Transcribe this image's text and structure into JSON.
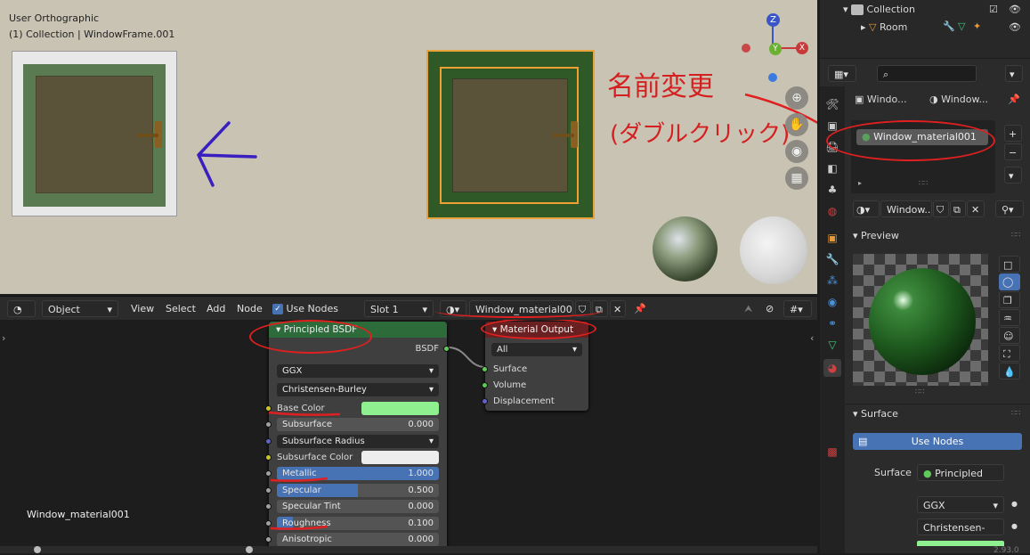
{
  "viewport": {
    "view_name": "User Orthographic",
    "collection_line": "(1) Collection | WindowFrame.001",
    "annotation_line1": "名前変更",
    "annotation_line2": "(ダブルクリック)",
    "gizmo_z": "Z",
    "gizmo_y": "Y",
    "gizmo_x": "X"
  },
  "node_header": {
    "editor_type": "Object",
    "menus": [
      "View",
      "Select",
      "Add",
      "Node"
    ],
    "use_nodes_label": "Use Nodes",
    "use_nodes_checked": true,
    "slot": "Slot 1",
    "material_name": "Window_material001"
  },
  "node_editor": {
    "material_label": "Window_material001",
    "bsdf_node": {
      "title": "Principled BSDF",
      "output_label": "BSDF",
      "distribution": "GGX",
      "subsurface_method": "Christensen-Burley",
      "base_color_label": "Base Color",
      "base_color": "#8ff08f",
      "subsurface": {
        "label": "Subsurface",
        "value": "0.000"
      },
      "subsurface_radius": "Subsurface Radius",
      "subsurface_color_label": "Subsurface Color",
      "metallic": {
        "label": "Metallic",
        "value": "1.000",
        "fraction": 1.0
      },
      "specular": {
        "label": "Specular",
        "value": "0.500",
        "fraction": 0.5
      },
      "specular_tint": {
        "label": "Specular Tint",
        "value": "0.000"
      },
      "roughness": {
        "label": "Roughness",
        "value": "0.100",
        "fraction": 0.1
      },
      "anisotropic": {
        "label": "Anisotropic",
        "value": "0.000"
      }
    },
    "output_node": {
      "title": "Material Output",
      "target": "All",
      "inputs": [
        "Surface",
        "Volume",
        "Displacement"
      ]
    }
  },
  "outliner": {
    "collection": "Collection",
    "room": "Room"
  },
  "properties": {
    "breadcrumb_1": "Windo...",
    "breadcrumb_2": "Window...",
    "slot_item": "Window_material001",
    "material_field": "Window...",
    "preview_label": "Preview",
    "surface_label": "Surface",
    "use_nodes_button": "Use Nodes",
    "surface_field_label": "Surface",
    "surface_value": "Principled BS...",
    "distribution": "GGX",
    "subsurface_method": "Christensen-B...",
    "version": "2.93.0"
  },
  "colors": {
    "bsdf_header": "#2d6b3a",
    "output_header": "#6a2020",
    "accent_blue": "#4772b3",
    "annotation_red": "#e02020",
    "arrow_blue": "#3a1fc0"
  }
}
